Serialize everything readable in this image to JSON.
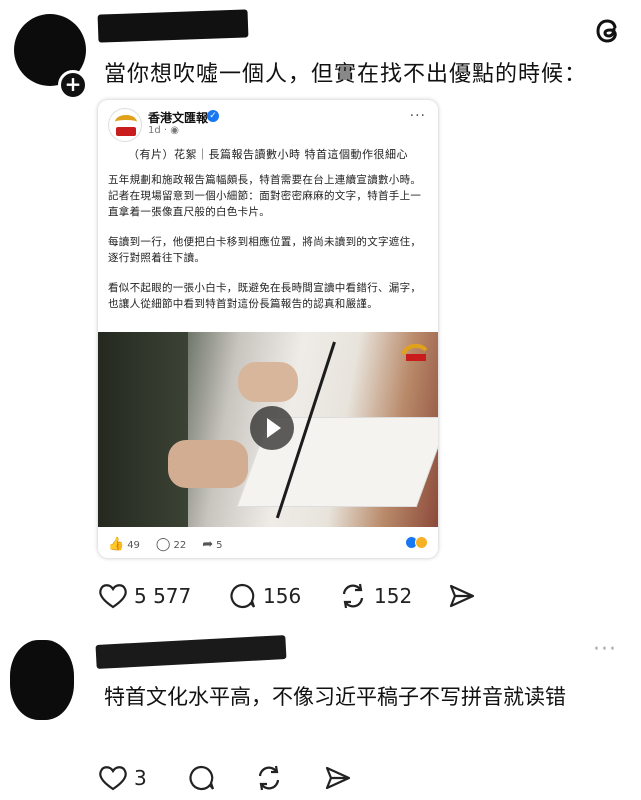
{
  "post": {
    "text": "當你想吹噓一個人，但實在找不出優點的時候：",
    "likes": "5 577",
    "comments": "156",
    "reposts": "152"
  },
  "embedded": {
    "page_name": "香港文匯報",
    "time": "1d · ",
    "headline": "（有片）花絮｜長篇報告讀數小時 特首這個動作很細心",
    "paragraphs": [
      "五年規劃和施政報告篇幅頗長，特首需要在台上連續宣讀數小時。記者在現場留意到一個小細節：面對密密麻麻的文字，特首手上一直拿着一張像直尺般的白色卡片。",
      "每讀到一行，他便把白卡移到相應位置，將尚未讀到的文字遮住，逐行對照着往下讀。",
      "看似不起眼的一張小白卡，既避免在長時間宣讀中看錯行、漏字，也讓人從細節中看到特首對這份長篇報告的認真和嚴謹。"
    ],
    "likes": "49",
    "comments": "22",
    "shares": "5"
  },
  "reply": {
    "text": "特首文化水平高，不像习近平稿子不写拼音就读错",
    "likes": "3"
  },
  "icons": {
    "threads": "threads-logo-icon",
    "plus": "plus-icon",
    "heart": "heart-icon",
    "comment": "comment-bubble-icon",
    "repost": "repost-icon",
    "share": "send-icon"
  }
}
